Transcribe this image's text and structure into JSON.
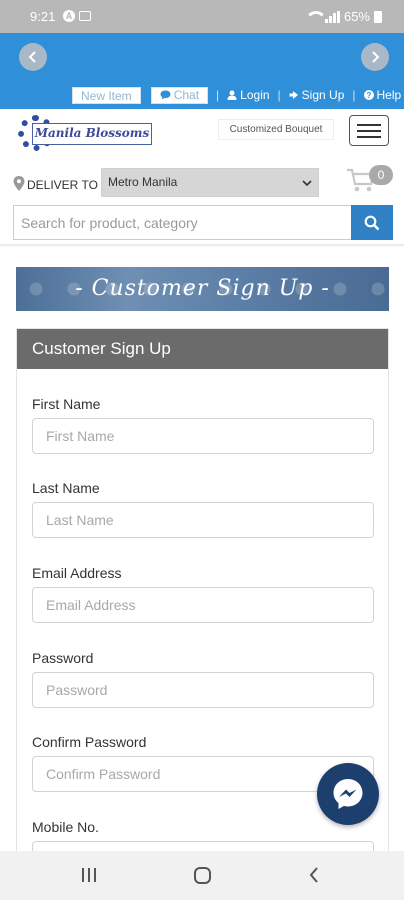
{
  "status_bar": {
    "time": "9:21",
    "battery": "65%",
    "app_icon_letter": "A"
  },
  "header": {
    "new_item": "New Item",
    "chat": "Chat",
    "login": "Login",
    "sign_up": "Sign Up",
    "help": "Help",
    "sep": "|"
  },
  "brand": {
    "logo_text": "Manila Blossoms",
    "customized_bouquet": "Customized Bouquet"
  },
  "deliver": {
    "label": "DELIVER TO",
    "selected": "Metro Manila",
    "cart_count": "0"
  },
  "search": {
    "placeholder": "Search for product, category"
  },
  "banner": {
    "text": "- Customer Sign Up -"
  },
  "form": {
    "title": "Customer Sign Up",
    "fields": [
      {
        "label": "First Name",
        "placeholder": "First Name"
      },
      {
        "label": "Last Name",
        "placeholder": "Last Name"
      },
      {
        "label": "Email Address",
        "placeholder": "Email Address"
      },
      {
        "label": "Password",
        "placeholder": "Password"
      },
      {
        "label": "Confirm Password",
        "placeholder": "Confirm Password"
      },
      {
        "label": "Mobile No.",
        "placeholder": ""
      }
    ]
  },
  "colors": {
    "header_blue": "#2f90d9",
    "search_button": "#2f80c4",
    "card_header": "#6b6b6b",
    "messenger": "#1d3f6e"
  },
  "icons": {
    "prev": "chevron-left-icon",
    "next": "chevron-right-icon",
    "chat": "speech-bubble-icon",
    "login": "user-icon",
    "sign_up": "sign-in-icon",
    "help": "question-circle-icon",
    "menu": "hamburger-icon",
    "location": "map-pin-icon",
    "cart": "shopping-cart-icon",
    "search": "search-icon",
    "messenger": "messenger-icon"
  }
}
